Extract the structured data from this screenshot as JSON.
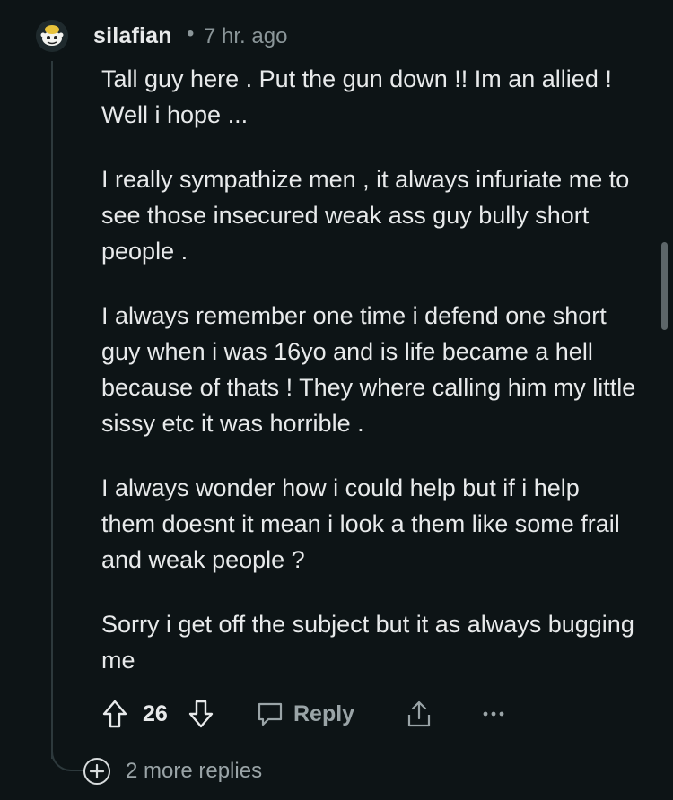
{
  "comment": {
    "username": "silafian",
    "separator": "•",
    "timestamp": "7 hr. ago",
    "paragraphs": [
      "Tall guy here . Put the gun down !! Im an allied ! Well i hope ...",
      "I really sympathize men , it always infuriate me to see those insecured weak ass guy bully short people .",
      "I always remember one time i defend one short guy when i was 16yo and is life became a hell because of thats ! They where calling him my little sissy etc it was horrible .",
      "I always wonder how i could help but if i help them doesnt it mean i look a them like some frail and weak people ?",
      "Sorry i get off the subject but it as always bugging me"
    ],
    "actions": {
      "vote_count": "26",
      "reply_label": "Reply"
    },
    "more_replies_label": "2 more replies"
  },
  "icons": {
    "avatar": "snoo-avatar-icon",
    "upvote": "upvote-arrow-icon",
    "downvote": "downvote-arrow-icon",
    "reply": "speech-bubble-icon",
    "share": "share-icon",
    "more": "ellipsis-icon",
    "expand": "plus-circle-icon"
  },
  "colors": {
    "background": "#0d1416",
    "text": "#e8eaeb",
    "muted": "#8b9699",
    "thread_line": "#2d393c"
  }
}
